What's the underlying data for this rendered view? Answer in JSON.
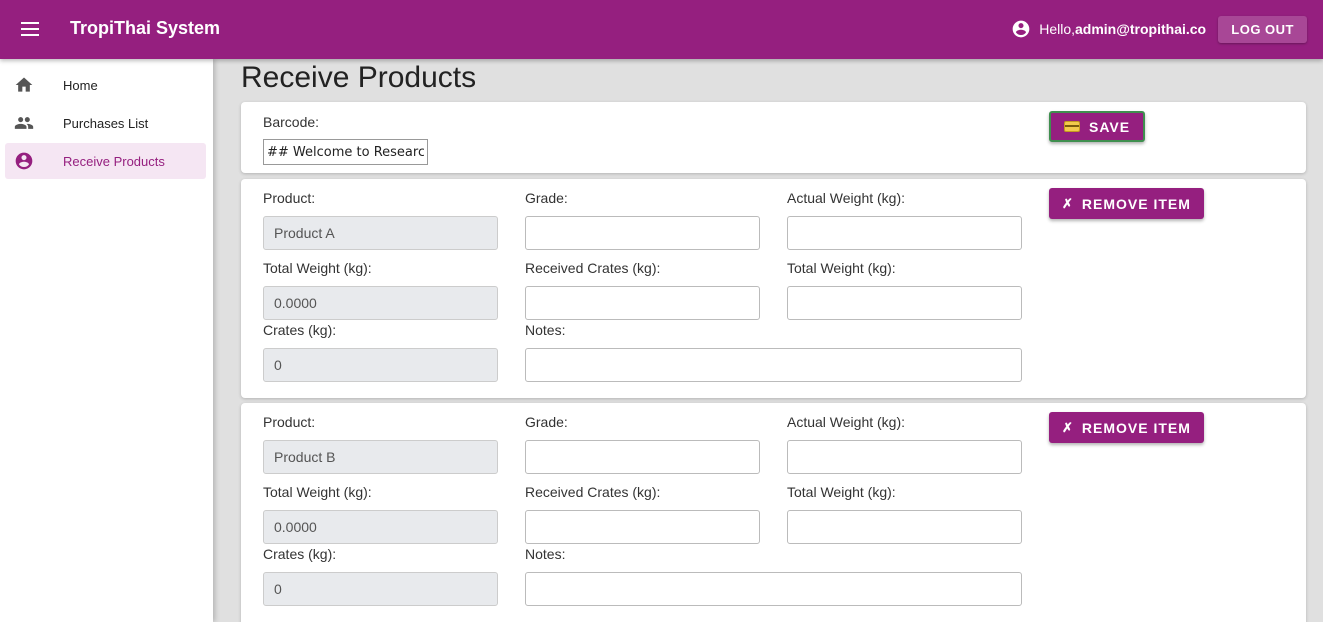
{
  "app": {
    "title": "TropiThai System"
  },
  "header": {
    "hello_prefix": "Hello, ",
    "user_email": "admin@tropithai.com!",
    "logout_label": "LOG OUT"
  },
  "sidebar": {
    "items": [
      {
        "label": "Home",
        "icon": "home-icon",
        "active": false
      },
      {
        "label": "Purchases List",
        "icon": "people-icon",
        "active": false
      },
      {
        "label": "Receive Products",
        "icon": "account-circle-icon",
        "active": true
      }
    ]
  },
  "page": {
    "title": "Receive Products"
  },
  "barcode": {
    "label": "Barcode:",
    "value": "## Welcome to Research",
    "save_label": "SAVE"
  },
  "labels": {
    "product": "Product:",
    "grade": "Grade:",
    "actual_weight": "Actual Weight (kg):",
    "total_weight": "Total Weight (kg):",
    "received_crates": "Received Crates (kg):",
    "crates": "Crates (kg):",
    "notes": "Notes:",
    "remove_item": "REMOVE ITEM"
  },
  "items": [
    {
      "product": "Product A",
      "total_weight": "0.0000",
      "crates": "0",
      "grade": "",
      "actual_weight": "",
      "received_crates": "",
      "total_weight_2": "",
      "notes": ""
    },
    {
      "product": "Product B",
      "total_weight": "0.0000",
      "crates": "0",
      "grade": "",
      "actual_weight": "",
      "received_crates": "",
      "total_weight_2": "",
      "notes": ""
    }
  ]
}
